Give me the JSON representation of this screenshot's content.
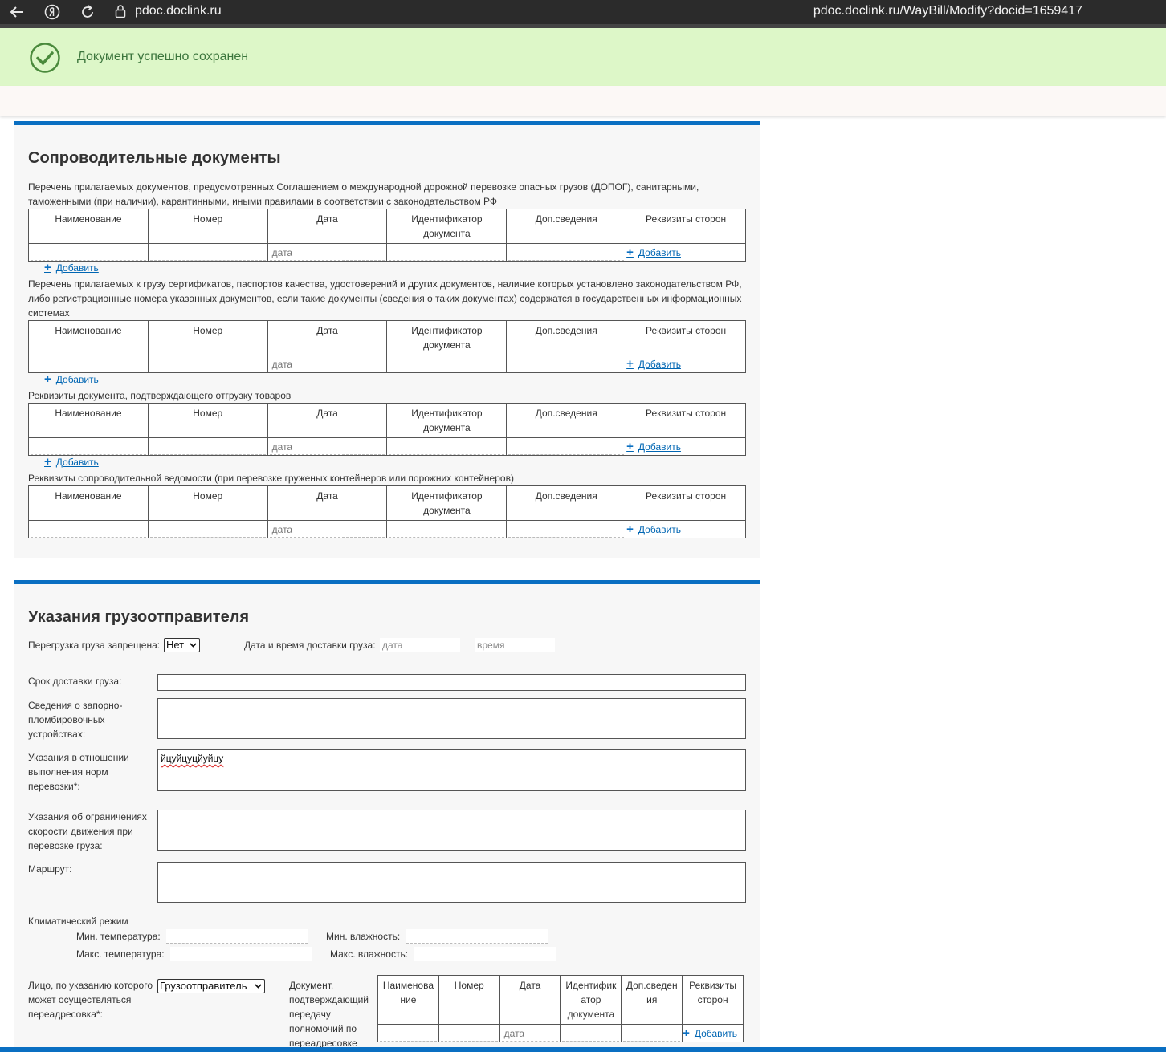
{
  "browser": {
    "domain": "pdoc.doclink.ru",
    "url": "pdoc.doclink.ru/WayBill/Modify?docid=1659417"
  },
  "banner": {
    "message": "Документ успешно сохранен"
  },
  "columns": [
    "Наименование",
    "Номер",
    "Дата",
    "Идентификатор документа",
    "Доп.сведения",
    "Реквизиты сторон"
  ],
  "date_placeholder": "дата",
  "time_placeholder": "время",
  "add_label": "Добавить",
  "docs": {
    "title": "Сопроводительные документы",
    "caption1": "Перечень прилагаемых документов, предусмотренных Соглашением о международной дорожной перевозке опасных грузов (ДОПОГ), санитарными, таможенными (при наличии), карантинными, иными правилами в соответствии с законодательством РФ",
    "caption2": "Перечень прилагаемых к грузу сертификатов, паспортов качества, удостоверений и других документов, наличие которых установлено законодательством РФ, либо регистрационные номера указанных документов, если такие документы (сведения о таких документах) содержатся в государственных информационных системах",
    "caption3": "Реквизиты документа, подтверждающего отгрузку товаров",
    "caption4": "Реквизиты сопроводительной ведомости (при перевозке груженых контейнеров или порожних контейнеров)"
  },
  "shipper": {
    "title": "Указания грузоотправителя",
    "reload_label": "Перегрузка груза запрещена:",
    "reload_value": "Нет",
    "delivery_dt_label": "Дата и время доставки груза:",
    "term_label": "Срок доставки груза:",
    "seals_label": "Сведения о запорно-пломбировочных устройствах:",
    "norms_label": "Указания в отношении выполнения норм перевозки*:",
    "norms_value": "йцуйцуцйуйцу",
    "speed_label": "Указания об ограничениях скорости движения при перевозке груза:",
    "route_label": "Маршрут:",
    "climate_label": "Климатический режим",
    "min_temp_label": "Мин. температура:",
    "max_temp_label": "Макс. температура:",
    "min_hum_label": "Мин. влажность:",
    "max_hum_label": "Макс. влажность:",
    "redirect_label": "Лицо, по указанию которого может осуществляться переадресовка*:",
    "redirect_value": "Грузоотправитель",
    "redirect_doc_label": "Документ, подтверждающий передачу полномочий по переадресовке",
    "small_columns": [
      "Наименова ние",
      "Номер",
      "Дата",
      "Идентифик атор документа",
      "Доп.сведен ия",
      "Реквизиты сторон"
    ]
  },
  "colors": {
    "accent": "#0a6fc2",
    "success_bg": "#ddf7c8",
    "success_text": "#3c763d",
    "link": "#0066b3"
  }
}
